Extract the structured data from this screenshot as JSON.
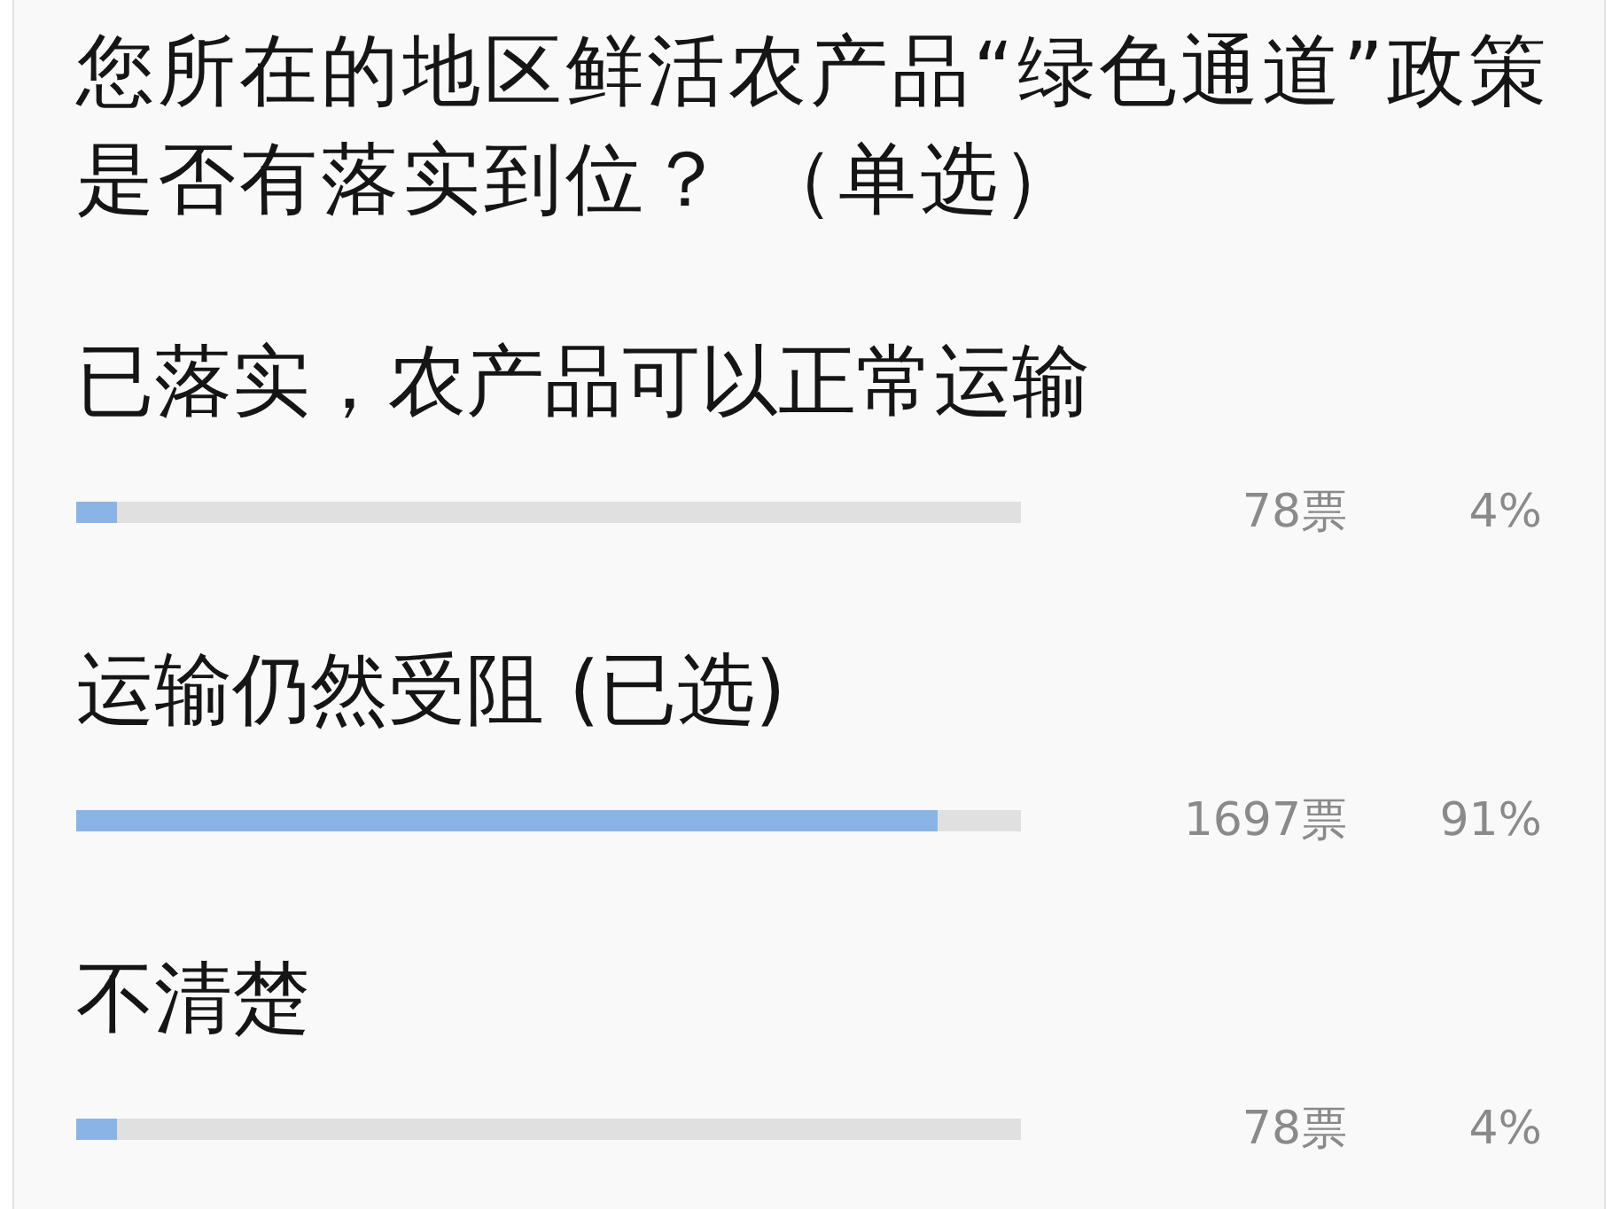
{
  "question": "您所在的地区鲜活农产品“绿色通道”政策是否有落实到位？ （单选）",
  "options": [
    {
      "label": "已落实，农产品可以正常运输",
      "level": 0.043,
      "votes": "78票",
      "percent": "4%"
    },
    {
      "label": "运输仍然受阻 (已选)",
      "level": 0.912,
      "votes": "1697票",
      "percent": "91%"
    },
    {
      "label": "不清楚",
      "level": 0.043,
      "votes": "78票",
      "percent": "4%"
    }
  ]
}
